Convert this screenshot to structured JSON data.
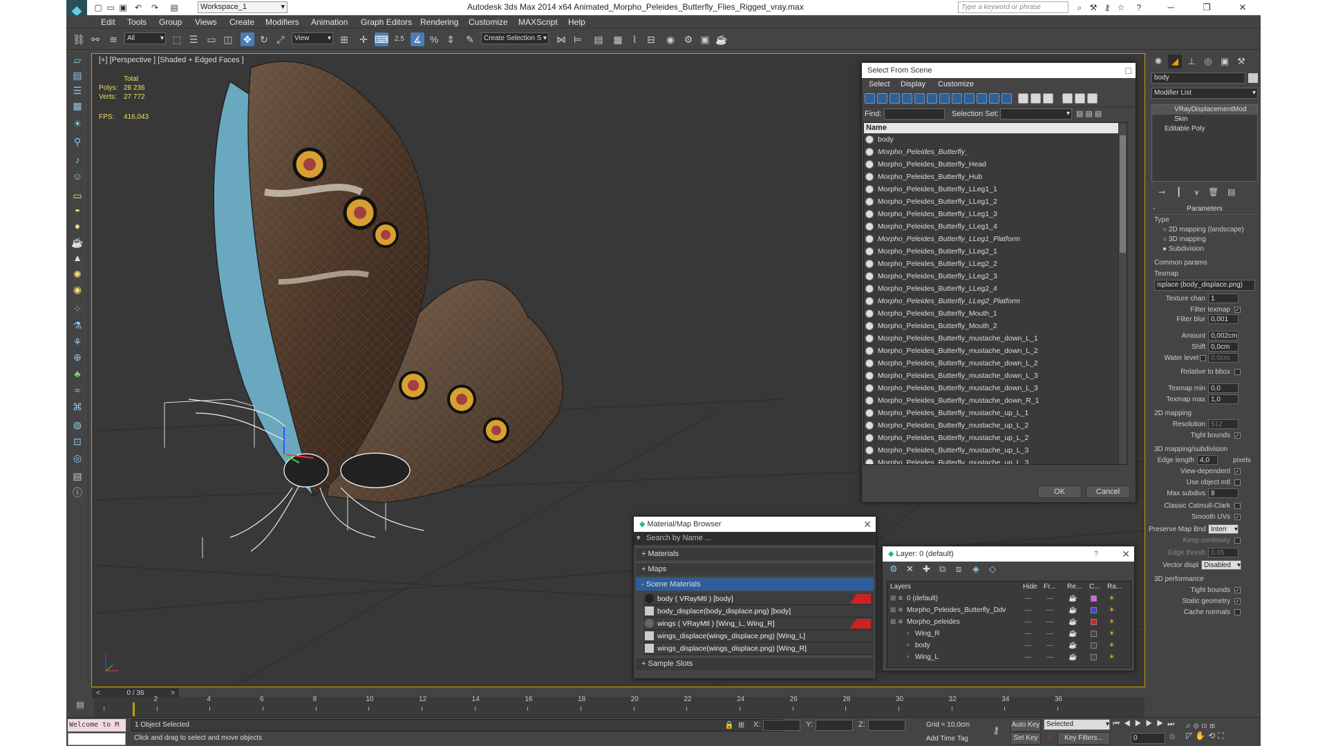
{
  "app": {
    "workspace": "Workspace_1",
    "title": "Autodesk 3ds Max  2014 x64    Animated_Morpho_Peleides_Butterfly_Flies_Rigged_vray.max",
    "search_placeholder": "Type a keyword or phrase"
  },
  "menus": [
    "Edit",
    "Tools",
    "Group",
    "Views",
    "Create",
    "Modifiers",
    "Animation",
    "Graph Editors",
    "Rendering",
    "Customize",
    "MAXScript",
    "Help"
  ],
  "toolbar": {
    "filter": "All",
    "refcoord": "View",
    "named_selection": "Create Selection S",
    "snap_label": "2.5"
  },
  "viewport": {
    "label": "[+] [Perspective ] [Shaded + Edged Faces ]",
    "stats_total": "Total",
    "polys_label": "Polys:",
    "polys": "28 236",
    "verts_label": "Verts:",
    "verts": "27 772",
    "fps_label": "FPS:",
    "fps": "416,043"
  },
  "select_from_scene": {
    "title": "Select From Scene",
    "menu": [
      "Select",
      "Display",
      "Customize"
    ],
    "find_label": "Find:",
    "selection_set_label": "Selection Set:",
    "column_name": "Name",
    "items": [
      {
        "name": "body",
        "italic": false
      },
      {
        "name": "Morpho_Peleides_Butterfly_",
        "italic": true
      },
      {
        "name": "Morpho_Peleides_Butterfly_Head",
        "italic": false
      },
      {
        "name": "Morpho_Peleides_Butterfly_Hub",
        "italic": false
      },
      {
        "name": "Morpho_Peleides_Butterfly_LLeg1_1",
        "italic": false
      },
      {
        "name": "Morpho_Peleides_Butterfly_LLeg1_2",
        "italic": false
      },
      {
        "name": "Morpho_Peleides_Butterfly_LLeg1_3",
        "italic": false
      },
      {
        "name": "Morpho_Peleides_Butterfly_LLeg1_4",
        "italic": false
      },
      {
        "name": "Morpho_Peleides_Butterfly_LLeg1_Platform",
        "italic": true
      },
      {
        "name": "Morpho_Peleides_Butterfly_LLeg2_1",
        "italic": false
      },
      {
        "name": "Morpho_Peleides_Butterfly_LLeg2_2",
        "italic": false
      },
      {
        "name": "Morpho_Peleides_Butterfly_LLeg2_3",
        "italic": false
      },
      {
        "name": "Morpho_Peleides_Butterfly_LLeg2_4",
        "italic": false
      },
      {
        "name": "Morpho_Peleides_Butterfly_LLeg2_Platform",
        "italic": true
      },
      {
        "name": "Morpho_Peleides_Butterfly_Mouth_1",
        "italic": false
      },
      {
        "name": "Morpho_Peleides_Butterfly_Mouth_2",
        "italic": false
      },
      {
        "name": "Morpho_Peleides_Butterfly_mustache_down_L_1",
        "italic": false
      },
      {
        "name": "Morpho_Peleides_Butterfly_mustache_down_L_2",
        "italic": false
      },
      {
        "name": "Morpho_Peleides_Butterfly_mustache_down_L_2",
        "italic": false
      },
      {
        "name": "Morpho_Peleides_Butterfly_mustache_down_L_3",
        "italic": false
      },
      {
        "name": "Morpho_Peleides_Butterfly_mustache_down_L_3",
        "italic": false
      },
      {
        "name": "Morpho_Peleides_Butterfly_mustache_down_R_1",
        "italic": false
      },
      {
        "name": "Morpho_Peleides_Butterfly_mustache_up_L_1",
        "italic": false
      },
      {
        "name": "Morpho_Peleides_Butterfly_mustache_up_L_2",
        "italic": false
      },
      {
        "name": "Morpho_Peleides_Butterfly_mustache_up_L_2",
        "italic": false
      },
      {
        "name": "Morpho_Peleides_Butterfly_mustache_up_L_3",
        "italic": false
      },
      {
        "name": "Morpho_Peleides_Butterfly_mustache_up_L_3",
        "italic": false
      }
    ],
    "ok": "OK",
    "cancel": "Cancel"
  },
  "material_browser": {
    "title": "Material/Map Browser",
    "search_placeholder": "Search by Name ...",
    "rollouts": {
      "materials": "+ Materials",
      "maps": "+ Maps",
      "scene": "- Scene Materials",
      "sample": "+ Sample Slots"
    },
    "scene_items": [
      "body  ( VRayMtl ) [body]",
      "body_displace(body_displace.png) [body]",
      "wings  ( VRayMtl ) [Wing_L, Wing_R]",
      "wings_displace(wings_displace.png) [Wing_L]",
      "wings_displace(wings_displace.png) [Wing_R]"
    ]
  },
  "layer_dialog": {
    "title": "Layer: 0 (default)",
    "help": "?",
    "cols": {
      "layers": "Layers",
      "hide": "Hide",
      "freeze": "Fr...",
      "render": "Re...",
      "color": "C...",
      "radiosity": "Ra..."
    },
    "rows": [
      {
        "name": "0 (default)",
        "indent": 0,
        "color": "#e060e0"
      },
      {
        "name": "Morpho_Peleides_Butterfly_Ddv",
        "indent": 0,
        "color": "#4040e0"
      },
      {
        "name": "Morpho_peleides",
        "indent": 0,
        "color": "#e02020"
      },
      {
        "name": "Wing_R",
        "indent": 1,
        "color": "#444444"
      },
      {
        "name": "body",
        "indent": 1,
        "color": "#444444"
      },
      {
        "name": "Wing_L",
        "indent": 1,
        "color": "#444444"
      }
    ]
  },
  "command_panel": {
    "object_name": "body",
    "modifier_list": "Modifier List",
    "stack": [
      "VRayDisplacementMod",
      "Skin",
      "Editable Poly"
    ],
    "parameters": "Parameters",
    "type_label": "Type",
    "type_options": [
      "2D mapping (landscape)",
      "3D mapping",
      "Subdivision"
    ],
    "common_params": "Common params",
    "texmap_label": "Texmap",
    "texmap_value": "isplace (body_displace.png)",
    "fields": {
      "texture_chan": {
        "label": "Texture chan",
        "value": "1"
      },
      "filter_texmap": {
        "label": "Filter texmap"
      },
      "filter_blur": {
        "label": "Filter blur",
        "value": "0,001"
      },
      "amount": {
        "label": "Amount",
        "value": "0,002cm"
      },
      "shift": {
        "label": "Shift",
        "value": "0,0cm"
      },
      "water_level": {
        "label": "Water level",
        "value": "0,0cm"
      },
      "relative_bbox": {
        "label": "Relative to bbox"
      },
      "texmap_min": {
        "label": "Texmap min",
        "value": "0,0"
      },
      "texmap_max": {
        "label": "Texmap max",
        "value": "1,0"
      }
    },
    "mapping2d": "2D mapping",
    "resolution": {
      "label": "Resolution",
      "value": "512"
    },
    "tight_bounds": "Tight bounds",
    "mapping3d": "3D mapping/subdivision",
    "edge_length": {
      "label": "Edge length",
      "value": "4,0",
      "unit": "pixels"
    },
    "view_dependent": "View-dependent",
    "use_object_mtl": "Use object mtl",
    "max_subdivs": {
      "label": "Max subdivs",
      "value": "8"
    },
    "classic_catmull": "Classic Catmull-Clark",
    "smooth_uvs": "Smooth UVs",
    "preserve_map": {
      "label": "Preserve Map Bnd",
      "value": "Interr"
    },
    "keep_continuity": "Keep continuity",
    "edge_thresh": {
      "label": "Edge thresh",
      "value": "0,05"
    },
    "vector_displ": {
      "label": "Vector displ",
      "value": "Disabled"
    },
    "perf": "3D performance",
    "tight_bounds2": "Tight bounds",
    "static_geometry": "Static geometry",
    "cache_normals": "Cache normals"
  },
  "timeline": {
    "frame_display": "0 / 36",
    "ticks": [
      "0",
      "2",
      "4",
      "6",
      "8",
      "10",
      "12",
      "14",
      "16",
      "18",
      "20",
      "22",
      "24",
      "26",
      "28",
      "30",
      "32",
      "34",
      "36"
    ]
  },
  "statusbar": {
    "maxscript": "Welcome to M",
    "objects_selected": "1 Object Selected",
    "prompt": "Click and drag to select and move objects",
    "x_label": "X:",
    "y_label": "Y:",
    "z_label": "Z:",
    "grid": "Grid = 10,0cm",
    "add_time_tag": "Add Time Tag",
    "auto_key": "Auto Key",
    "set_key": "Set Key",
    "key_mode": "Selected",
    "key_filters": "Key Filters...",
    "frame": "0"
  },
  "colors": {
    "ui_bg": "#444444",
    "viewport_bg": "#383838",
    "accent_blue": "#2d5e99",
    "viewport_border": "#c8a000",
    "stats_yellow": "#e8e060"
  }
}
